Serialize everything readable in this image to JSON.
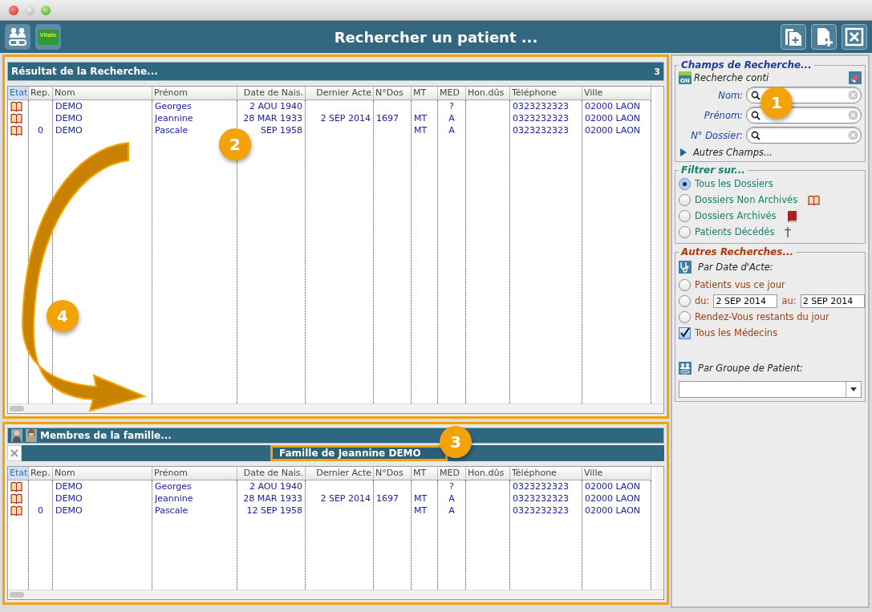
{
  "window": {
    "title": "Rechercher un patient ..."
  },
  "toolbar": {
    "card_label": "Vitale"
  },
  "results": {
    "title": "Résultat de la Recherche...",
    "count": "3",
    "columns": [
      {
        "label": "Etat",
        "selected": true
      },
      {
        "label": "Rep.",
        "selected": false
      },
      {
        "label": "Nom",
        "selected": false
      },
      {
        "label": "Prénom",
        "selected": false
      },
      {
        "label": "Date de Nais.",
        "selected": false
      },
      {
        "label": "Dernier Acte",
        "selected": false
      },
      {
        "label": "N°Dos",
        "selected": false
      },
      {
        "label": "MT",
        "selected": false
      },
      {
        "label": "MED",
        "selected": false
      },
      {
        "label": "Hon.dûs",
        "selected": false
      },
      {
        "label": "Téléphone",
        "selected": false
      },
      {
        "label": "Ville",
        "selected": false
      }
    ],
    "rows": [
      {
        "nom": "DEMO",
        "prenom": "Georges",
        "date_naissance": "2 AOU 1940",
        "med": "?",
        "telephone": "0323232323",
        "ville": "02000 LAON"
      },
      {
        "nom": "DEMO",
        "prenom": "Jeannine",
        "date_naissance": "28 MAR 1933",
        "dernier_acte": "2 SEP 2014",
        "n_dos": "1697",
        "mt": "MT",
        "med": "A",
        "telephone": "0323232323",
        "ville": "02000 LAON"
      },
      {
        "rep": "0",
        "nom": "DEMO",
        "prenom": "Pascale",
        "date_naissance": "SEP 1958",
        "mt": "MT",
        "med": "A",
        "telephone": "0323232323",
        "ville": "02000 LAON"
      }
    ]
  },
  "family": {
    "title": "Membres de la famille...",
    "tab": {
      "label": "Famille de Jeannine DEMO",
      "selected": true
    },
    "columns": [
      {
        "label": "Etat",
        "selected": true
      },
      {
        "label": "Rep.",
        "selected": false
      },
      {
        "label": "Nom",
        "selected": false
      },
      {
        "label": "Prénom",
        "selected": false
      },
      {
        "label": "Date de Nais.",
        "selected": false
      },
      {
        "label": "Dernier Acte",
        "selected": false
      },
      {
        "label": "N°Dos",
        "selected": false
      },
      {
        "label": "MT",
        "selected": false
      },
      {
        "label": "MED",
        "selected": false
      },
      {
        "label": "Hon.dûs",
        "selected": false
      },
      {
        "label": "Téléphone",
        "selected": false
      },
      {
        "label": "Ville",
        "selected": false
      }
    ],
    "rows": [
      {
        "nom": "DEMO",
        "prenom": "Georges",
        "date_naissance": "2 AOU 1940",
        "med": "?",
        "telephone": "0323232323",
        "ville": "02000 LAON"
      },
      {
        "nom": "DEMO",
        "prenom": "Jeannine",
        "date_naissance": "28 MAR 1933",
        "dernier_acte": "2 SEP 2014",
        "n_dos": "1697",
        "mt": "MT",
        "med": "A",
        "telephone": "0323232323",
        "ville": "02000 LAON"
      },
      {
        "rep": "0",
        "nom": "DEMO",
        "prenom": "Pascale",
        "date_naissance": "12 SEP 1958",
        "mt": "MT",
        "med": "A",
        "telephone": "0323232323",
        "ville": "02000 LAON"
      }
    ]
  },
  "search": {
    "title": "Champs de Recherche...",
    "live_badge": "ON",
    "live_label": "Recherche conti",
    "fields": [
      {
        "label": "Nom:"
      },
      {
        "label": "Prénom:"
      },
      {
        "label": "N° Dossier:"
      }
    ],
    "more": {
      "label": "Autres Champs...",
      "expanded": false
    }
  },
  "filter": {
    "title": "Filtrer sur...",
    "options": [
      {
        "kind": "all",
        "label": "Tous les Dossiers",
        "selected": true
      },
      {
        "kind": "open",
        "label": "Dossiers Non Archivés",
        "selected": false
      },
      {
        "kind": "archived",
        "label": "Dossiers Archivés",
        "selected": false
      },
      {
        "kind": "deceased",
        "label": "Patients Décédés",
        "selected": false
      }
    ]
  },
  "other": {
    "title": "Autres Recherches...",
    "date_heading": "Par Date d'Acte:",
    "options": [
      {
        "kind": "radio",
        "label": "Patients vus ce jour",
        "selected": false
      },
      {
        "kind": "range",
        "from_label": "du:",
        "from": "2 SEP 2014",
        "to_label": "au:",
        "to": "2 SEP 2014",
        "selected": false
      },
      {
        "kind": "radio",
        "label": "Rendez-Vous restants du jour",
        "selected": false
      }
    ],
    "all_doctors": {
      "label": "Tous les Médecins",
      "checked": true
    },
    "group_heading": "Par Groupe de Patient:"
  },
  "callouts": [
    {
      "number": "1"
    },
    {
      "number": "2"
    },
    {
      "number": "3"
    },
    {
      "number": "4"
    }
  ]
}
